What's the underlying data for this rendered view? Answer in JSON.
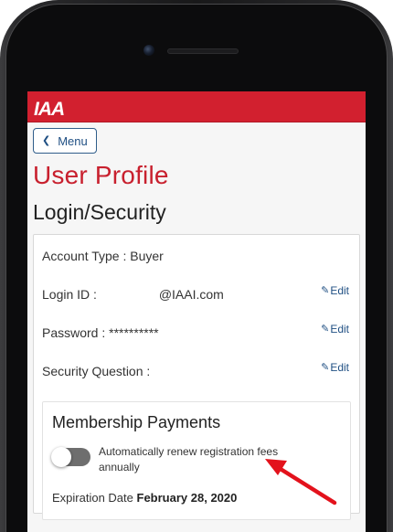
{
  "header": {
    "logo_text": "IAA",
    "brand_color": "#d2202f"
  },
  "nav": {
    "menu_label": "Menu"
  },
  "page": {
    "title": "User Profile",
    "section_title": "Login/Security"
  },
  "account": {
    "type_label": "Account Type :",
    "type_value": "Buyer",
    "login_label": "Login ID :",
    "login_value": "@IAAI.com",
    "password_label": "Password :",
    "password_value": "**********",
    "security_label": "Security Question :",
    "edit_label": "Edit"
  },
  "membership": {
    "title": "Membership Payments",
    "auto_renew_label": "Automatically renew registration fees annually",
    "auto_renew_on": false,
    "expiration_label": "Expiration Date",
    "expiration_value": "February 28, 2020"
  },
  "annotation": {
    "arrow_color": "#e3121c"
  }
}
